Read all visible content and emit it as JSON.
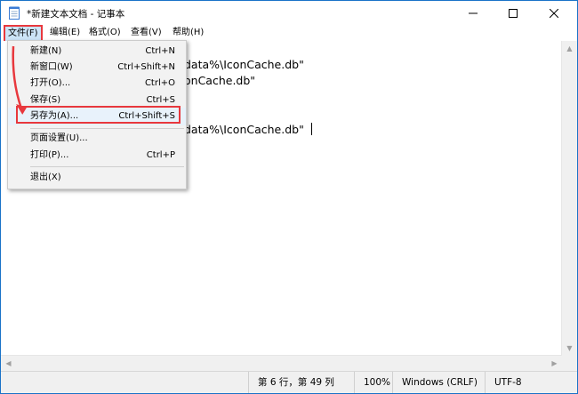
{
  "window": {
    "title": "*新建文本文档 - 记事本"
  },
  "menubar": {
    "items": [
      "文件(F)",
      "编辑(E)",
      "格式(O)",
      "查看(V)",
      "帮助(H)"
    ]
  },
  "editor": {
    "lines": [
      "data%\\IconCache.db\"",
      "onCache.db\"",
      "data%\\IconCache.db\""
    ]
  },
  "file_menu": {
    "items": [
      {
        "label": "新建(N)",
        "shortcut": "Ctrl+N"
      },
      {
        "label": "新窗口(W)",
        "shortcut": "Ctrl+Shift+N"
      },
      {
        "label": "打开(O)...",
        "shortcut": "Ctrl+O"
      },
      {
        "label": "保存(S)",
        "shortcut": "Ctrl+S"
      },
      {
        "label": "另存为(A)...",
        "shortcut": "Ctrl+Shift+S"
      },
      {
        "label": "页面设置(U)...",
        "shortcut": ""
      },
      {
        "label": "打印(P)...",
        "shortcut": "Ctrl+P"
      },
      {
        "label": "退出(X)",
        "shortcut": ""
      }
    ]
  },
  "statusbar": {
    "position": "第 6 行，第 49 列",
    "zoom": "100%",
    "line_ending": "Windows (CRLF)",
    "encoding": "UTF-8"
  },
  "colors": {
    "accent": "#1a73c8",
    "highlight_red": "#e8383d",
    "menu_hover": "#cce4f7"
  }
}
